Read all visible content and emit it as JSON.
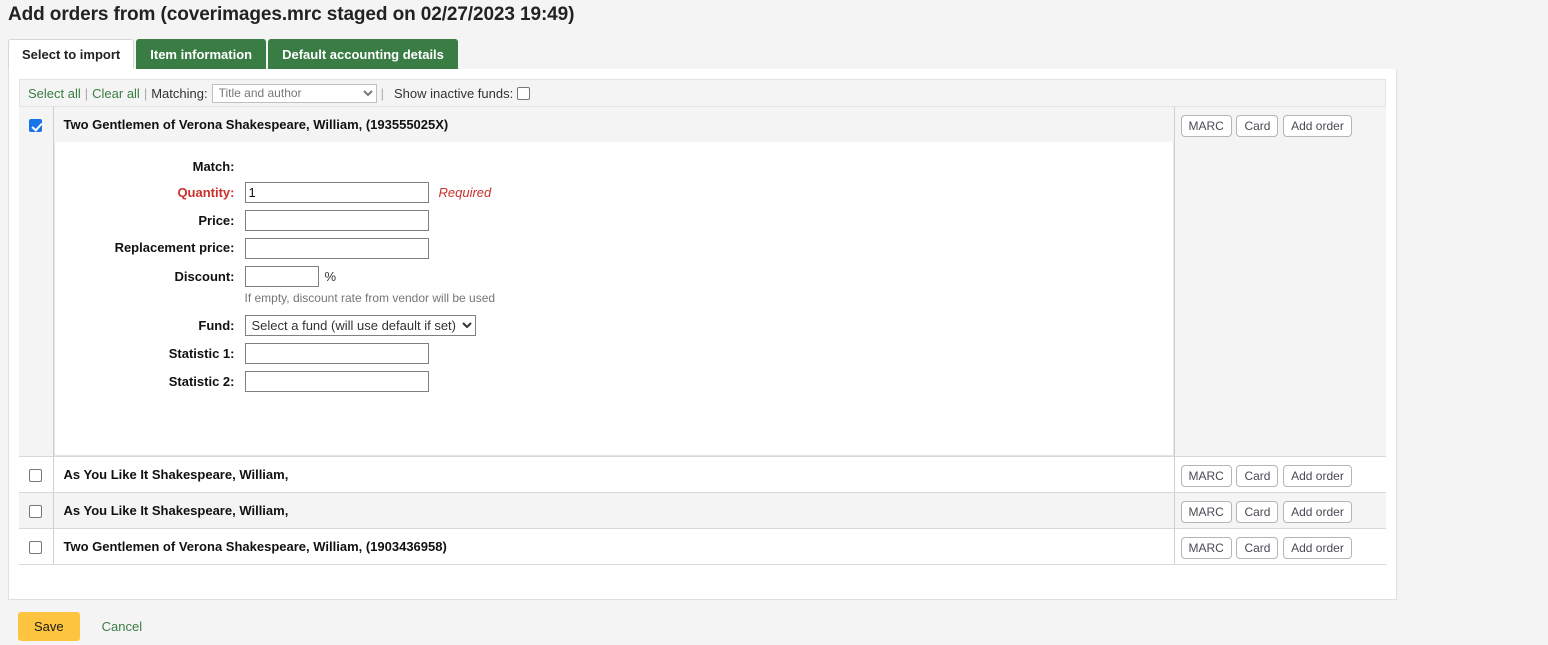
{
  "page": {
    "title": "Add orders from (coverimages.mrc staged on 02/27/2023 19:49)"
  },
  "tabs": [
    {
      "label": "Select to import",
      "active": true
    },
    {
      "label": "Item information",
      "active": false
    },
    {
      "label": "Default accounting details",
      "active": false
    }
  ],
  "toolbar": {
    "select_all": "Select all",
    "clear_all": "Clear all",
    "separator": "|",
    "matching_label": "Matching:",
    "matching_value": "Title and author",
    "matching_options": [
      "Title and author"
    ],
    "show_inactive_funds_label": "Show inactive funds:",
    "show_inactive_funds_checked": false
  },
  "row_buttons": {
    "marc": "MARC",
    "card": "Card",
    "add_order": "Add order"
  },
  "records": [
    {
      "title": "Two Gentlemen of Verona Shakespeare, William, (193555025X)",
      "selected": true,
      "expanded": true,
      "alt": false
    },
    {
      "title": "As You Like It Shakespeare, William,",
      "selected": false,
      "expanded": false,
      "alt": false
    },
    {
      "title": "As You Like It Shakespeare, William,",
      "selected": false,
      "expanded": false,
      "alt": true
    },
    {
      "title": "Two Gentlemen of Verona Shakespeare, William, (1903436958)",
      "selected": false,
      "expanded": false,
      "alt": false
    }
  ],
  "order_form": {
    "match_label": "Match:",
    "match_value": "",
    "quantity_label": "Quantity:",
    "quantity_value": "1",
    "quantity_required_note": "Required",
    "price_label": "Price:",
    "price_value": "",
    "replacement_price_label": "Replacement price:",
    "replacement_price_value": "",
    "discount_label": "Discount:",
    "discount_value": "",
    "discount_unit": "%",
    "discount_hint": "If empty, discount rate from vendor will be used",
    "fund_label": "Fund:",
    "fund_value": "Select a fund (will use default if set)",
    "fund_options": [
      "Select a fund (will use default if set)"
    ],
    "statistic1_label": "Statistic 1:",
    "statistic1_value": "",
    "statistic2_label": "Statistic 2:",
    "statistic2_value": ""
  },
  "footer": {
    "save_label": "Save",
    "cancel_label": "Cancel"
  },
  "colors": {
    "tab_green": "#3a7d44",
    "link_green": "#3a7d44",
    "required_red": "#c9302c",
    "save_yellow": "#fdc43f",
    "checkbox_blue": "#1a73e8"
  }
}
